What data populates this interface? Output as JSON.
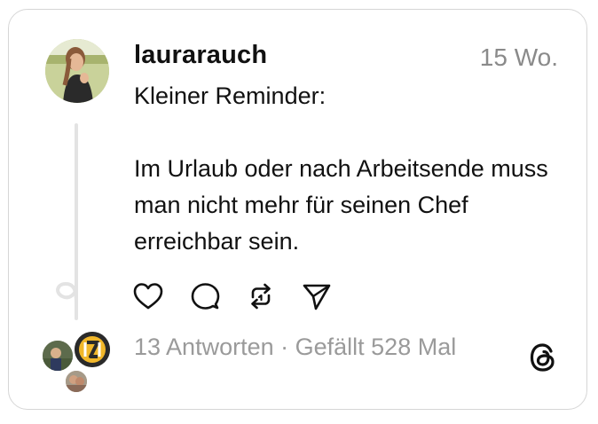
{
  "post": {
    "username": "laurarauch",
    "timestamp": "15 Wo.",
    "text": "Kleiner Reminder:\n\nIm Urlaub oder nach Arbeitsende muss man nicht mehr für seinen Chef erreichbar sein.",
    "replies_label": "13 Antworten",
    "separator": " · ",
    "likes_label": "Gefällt 528 Mal"
  },
  "icons": {
    "like": "heart-icon",
    "reply": "comment-icon",
    "repost": "repost-icon",
    "share": "send-icon",
    "brand": "threads-logo"
  },
  "colors": {
    "text": "#111111",
    "muted": "#8a8a8a",
    "border": "#d6d6d6",
    "thread_line": "#e3e3e3"
  }
}
